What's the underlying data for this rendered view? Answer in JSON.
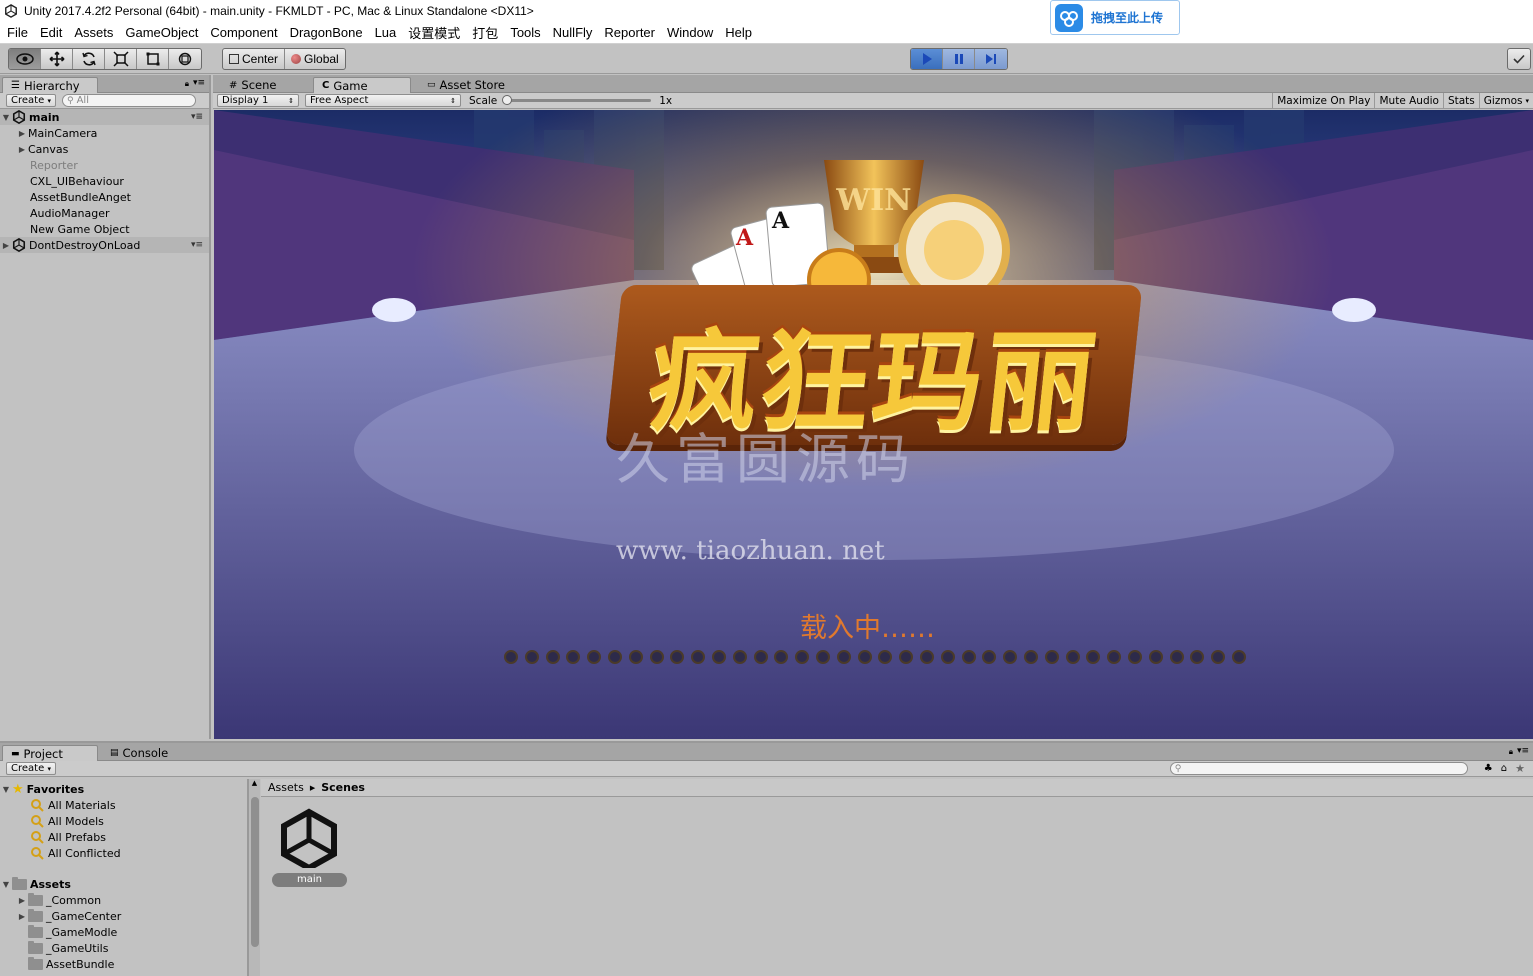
{
  "window": {
    "title": "Unity 2017.4.2f2 Personal (64bit) - main.unity - FKMLDT - PC, Mac & Linux Standalone <DX11>"
  },
  "upload_widget": {
    "label": "拖拽至此上传"
  },
  "menu": [
    "File",
    "Edit",
    "Assets",
    "GameObject",
    "Component",
    "DragonBone",
    "Lua",
    "设置模式",
    "打包",
    "Tools",
    "NullFly",
    "Reporter",
    "Window",
    "Help"
  ],
  "toolbar": {
    "pivot_center": "Center",
    "pivot_global": "Global"
  },
  "hierarchy": {
    "tab": "Hierarchy",
    "create": "Create",
    "search_placeholder": "All",
    "scene": "main",
    "items": [
      "MainCamera",
      "Canvas",
      "Reporter",
      "CXL_UIBehaviour",
      "AssetBundleAnget",
      "AudioManager",
      "New Game Object"
    ],
    "dontdestroy": "DontDestroyOnLoad"
  },
  "center_tabs": {
    "scene": "Scene",
    "game": "Game",
    "asset_store": "Asset Store"
  },
  "game_bar": {
    "display": "Display 1",
    "aspect": "Free Aspect",
    "scale_label": "Scale",
    "scale_value": "1x",
    "maximize": "Maximize On Play",
    "mute": "Mute Audio",
    "stats": "Stats",
    "gizmos": "Gizmos"
  },
  "game": {
    "logo_text": "疯狂玛丽",
    "trophy_text": "WIN",
    "watermark_cn": "久富圆源码",
    "watermark_url": "www. tiaozhuan. net",
    "loading_text": "载入中……",
    "loading_progress": 0,
    "colors": {
      "accent_orange": "#e0792e",
      "logo_gold": "#f6c83a"
    }
  },
  "project": {
    "tab_project": "Project",
    "tab_console": "Console",
    "create": "Create",
    "favorites_label": "Favorites",
    "favorites": [
      "All Materials",
      "All Models",
      "All Prefabs",
      "All Conflicted"
    ],
    "assets_label": "Assets",
    "assets": [
      "_Common",
      "_GameCenter",
      "_GameModle",
      "_GameUtils",
      "AssetBundle"
    ],
    "breadcrumb_root": "Assets",
    "breadcrumb_current": "Scenes",
    "files": [
      "main"
    ]
  }
}
